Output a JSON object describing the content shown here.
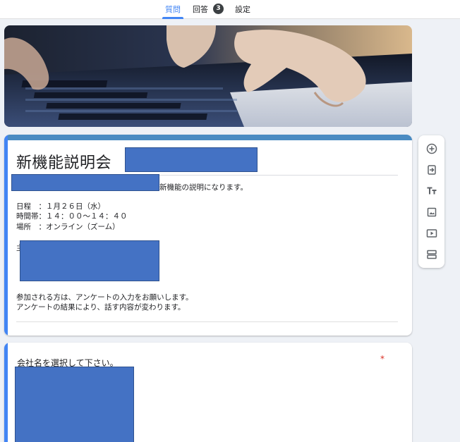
{
  "tabs": [
    {
      "label": "質問",
      "active": true
    },
    {
      "label": "回答",
      "active": false,
      "badge": "3"
    },
    {
      "label": "設定",
      "active": false
    }
  ],
  "form": {
    "title": "新機能説明会",
    "description_lines": [
      "新機能の説明になります。",
      "",
      "日程　：１月２６日（水）",
      "時間帯：１４：００〜１４：４０",
      "場所　：オンライン（ズーム）",
      "",
      "主",
      "",
      "",
      "",
      "参加される方は、アンケートの入力をお願いします。",
      "アンケートの結果により、話す内容が変わります。"
    ]
  },
  "question1": {
    "title": "会社名を選択して下さい。",
    "required_mark": "*"
  },
  "toolbar": {
    "items": [
      "add-question-icon",
      "import-questions-icon",
      "add-title-icon",
      "add-image-icon",
      "add-video-icon",
      "add-section-icon"
    ]
  },
  "colors": {
    "accent": "#4285f4",
    "header_stripe": "#4a8bc2",
    "redaction": "#4472c4",
    "required": "#d93025",
    "background": "#eef1f6"
  }
}
